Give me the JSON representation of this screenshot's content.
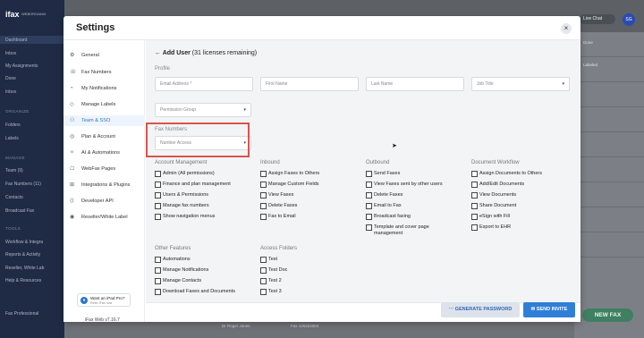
{
  "background": {
    "logo": "ifax",
    "org": "WEBORGANIX",
    "sidebar_items": [
      "Dashboard",
      "Inbox",
      "My Assignments",
      "Done",
      "Inbox"
    ],
    "section_organize": "ORGANIZE",
    "organize_items": [
      "Folders",
      "Labels"
    ],
    "section_manage": "MANAGE",
    "manage_items": [
      "Team (9)",
      "Fax Numbers (11)",
      "Contacts",
      "Broadcast Fax"
    ],
    "section_tools": "TOOLS",
    "tools_items": [
      "Workflow & Integra",
      "Reports & Activity",
      "Reseller, White Lab",
      "Help & Resources"
    ],
    "plan": "Fax Professional",
    "live_chat": "Live Chat",
    "avatar": "SG",
    "new_fax": "NEW FAX",
    "bottom_row": [
      "Dr Roger Jones",
      "Fax 125324004"
    ],
    "right_col": [
      "Done",
      "Labeled"
    ]
  },
  "modal": {
    "title": "Settings",
    "close": "×",
    "nav": [
      {
        "icon": "⚙",
        "label": "General"
      },
      {
        "icon": "☏",
        "label": "Fax Numbers"
      },
      {
        "icon": "◔",
        "label": "My Notifications"
      },
      {
        "icon": "◇",
        "label": "Manage Labels"
      },
      {
        "icon": "⚇",
        "label": "Team & SSO"
      },
      {
        "icon": "◎",
        "label": "Plan & Account"
      },
      {
        "icon": "✧",
        "label": "AI & Automations"
      },
      {
        "icon": "☖",
        "label": "WebFax Pages"
      },
      {
        "icon": "⊞",
        "label": "Integrations & Plugins"
      },
      {
        "icon": "⟨⟩",
        "label": "Developer API"
      },
      {
        "icon": "◉",
        "label": "Reseller/White Label"
      }
    ],
    "active_nav_index": 4,
    "ipad_title": "Want an iPad Pro?",
    "ipad_sub": "Refer iFax now",
    "version": "iFax Web v7.16.7"
  },
  "form": {
    "back_arrow": "←",
    "heading": "Add User",
    "remaining": "(31 licenses remaining)",
    "profile_label": "Profile",
    "email_placeholder": "Email Address *",
    "first_name_placeholder": "First Name",
    "last_name_placeholder": "Last Name",
    "job_title_placeholder": "Job Title",
    "permission_group_placeholder": "Permission Group",
    "fax_numbers_label": "Fax Numbers",
    "number_access_placeholder": "Number Access",
    "chevron": "▾",
    "columns": [
      {
        "title": "Account Management",
        "items": [
          "Admin (All permissions)",
          "Finance and plan management",
          "Users & Permissions",
          "Manage fax numbers",
          "Show navigation menus"
        ]
      },
      {
        "title": "Inbound",
        "items": [
          "Assign Faxes to Others",
          "Manage Custom Fields",
          "View Faxes",
          "Delete Faxes",
          "Fax to Email"
        ]
      },
      {
        "title": "Outbound",
        "items": [
          "Send Faxes",
          "View Faxes sent by other users",
          "Delete Faxes",
          "Email to Fax",
          "Broadcast faxing",
          "Template and cover page management"
        ]
      },
      {
        "title": "Document Workflow",
        "items": [
          "Assign Documents to Others",
          "Add/Edit Documents",
          "View Documents",
          "Share Document",
          "eSign with Fill",
          "Export to EHR"
        ]
      }
    ],
    "other_features": {
      "title": "Other Features",
      "items": [
        "Automations",
        "Manage Notifications",
        "Manage Contacts",
        "Download Faxes and Documents"
      ]
    },
    "access_folders": {
      "title": "Access Folders",
      "items": [
        "Test",
        "Test Doc",
        "Test 2",
        "Test 3"
      ]
    },
    "generate_password": "GENERATE PASSWORD",
    "send_invite": "SEND INVITE",
    "highlight_color": "#d9534f",
    "accent_color": "#2f7fd8"
  }
}
